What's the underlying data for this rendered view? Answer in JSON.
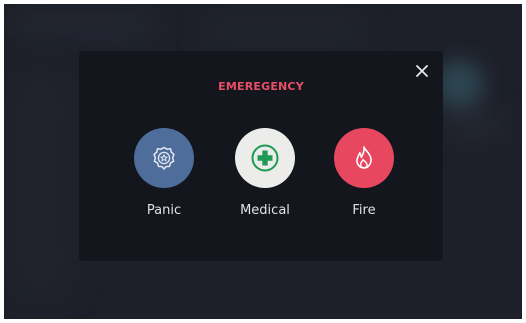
{
  "modal": {
    "title": "EMEREGENCY",
    "close_icon": "close-icon",
    "options": [
      {
        "label": "Panic",
        "icon": "police-badge-icon",
        "color": "#4e6d9b"
      },
      {
        "label": "Medical",
        "icon": "medical-cross-icon",
        "color": "#ecedea"
      },
      {
        "label": "Fire",
        "icon": "fire-icon",
        "color": "#e8485f"
      }
    ]
  },
  "colors": {
    "accent": "#e94d67",
    "modal_background": "#13161c",
    "screen_background": "#1d2029"
  }
}
